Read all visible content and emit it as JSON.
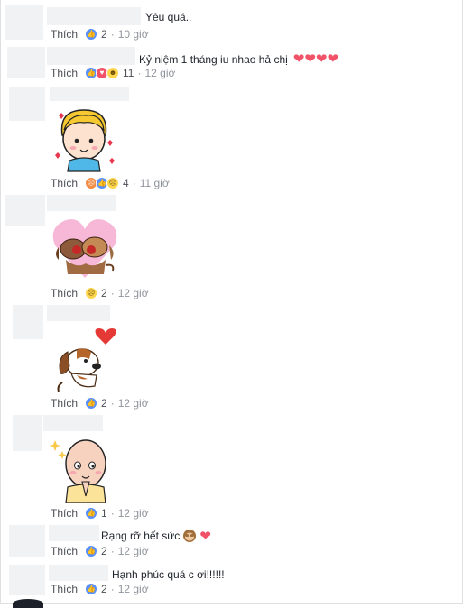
{
  "ui": {
    "like_label": "Thích",
    "dot": "·"
  },
  "comments": [
    {
      "text": "Yêu quá..",
      "reactions": [
        "like"
      ],
      "count": "2",
      "time": "10 giờ"
    },
    {
      "text": "Kỷ niệm 1 tháng iu nhao hả chị",
      "trailing": "❤❤❤❤",
      "reactions": [
        "like",
        "love",
        "haha"
      ],
      "count": "11",
      "time": "12 giờ"
    },
    {
      "sticker": "blond-boy-hearts-sticker",
      "reactions": [
        "angry",
        "like",
        "sad"
      ],
      "count": "4",
      "time": "11 giờ"
    },
    {
      "sticker": "dogs-in-heart-sticker",
      "reactions": [
        "sad"
      ],
      "count": "2",
      "time": "12 giờ"
    },
    {
      "sticker": "puppy-heart-sticker",
      "reactions": [
        "like"
      ],
      "count": "2",
      "time": "12 giờ"
    },
    {
      "sticker": "bald-man-praying-sticker",
      "reactions": [
        "like"
      ],
      "count": "1",
      "time": "12 giờ"
    },
    {
      "text": "Rạng rỡ hết sức",
      "trailing_emoji": "monkey-emoji",
      "trailing": "❤",
      "reactions": [
        "like"
      ],
      "count": "2",
      "time": "12 giờ"
    },
    {
      "text": "Hạnh phúc quá c ơi!!!!!!",
      "reactions": [
        "like"
      ],
      "count": "2",
      "time": "12 giờ"
    }
  ],
  "colors": {
    "link": "#4b4f56",
    "meta": "#90949c",
    "like": "#5890ff",
    "love": "#f25268",
    "placeholder": "#f1f2f4"
  }
}
